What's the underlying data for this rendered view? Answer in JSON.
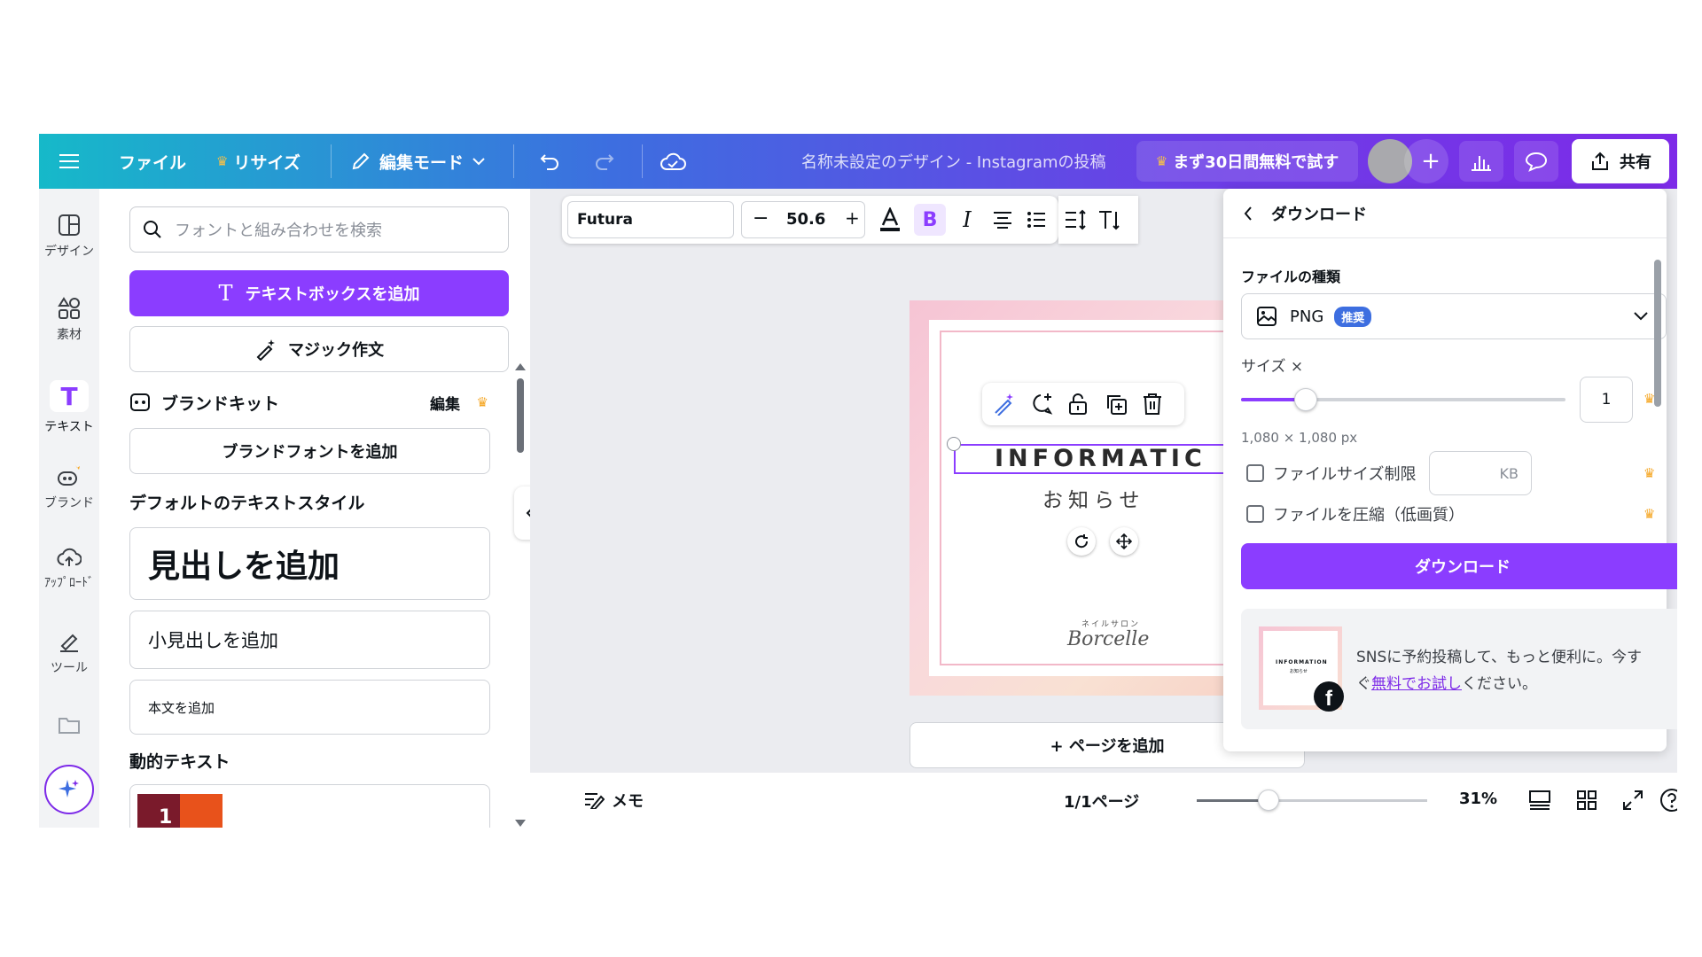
{
  "topbar": {
    "file_label": "ファイル",
    "resize_label": "リサイズ",
    "edit_mode_label": "編集モード",
    "doc_title": "名称未設定のデザイン - Instagramの投稿",
    "trial_label": "まず30日間無料で試す",
    "share_label": "共有"
  },
  "leftnav": {
    "items": [
      {
        "label": "デザイン"
      },
      {
        "label": "素材"
      },
      {
        "label": "テキスト"
      },
      {
        "label": "ブランド"
      },
      {
        "label": "ｱｯﾌﾟﾛｰﾄﾞ"
      },
      {
        "label": "ツール"
      }
    ]
  },
  "panel": {
    "search_placeholder": "フォントと組み合わせを検索",
    "add_textbox_label": "テキストボックスを追加",
    "magic_write_label": "マジック作文",
    "brand_kit_label": "ブランドキット",
    "brand_kit_edit": "編集",
    "add_brand_font_label": "ブランドフォントを追加",
    "default_styles_heading": "デフォルトのテキストスタイル",
    "heading_card": "見出しを追加",
    "subheading_card": "小見出しを追加",
    "body_card": "本文を追加",
    "dynamic_text_heading": "動的テキスト",
    "dynamic_thumb_num": "1"
  },
  "toolbar": {
    "font_name": "Futura",
    "font_size": "50.6",
    "minus": "−",
    "plus": "+",
    "bold": "B",
    "italic": "I"
  },
  "canvas": {
    "info_text": "INFORMATIC",
    "oshirase": "お知らせ",
    "brand_small": "ネイルサロン",
    "brand_name": "Borcelle",
    "add_page_label": "+ ページを追加"
  },
  "bottombar": {
    "memo_label": "メモ",
    "page_indicator": "1/1ページ",
    "zoom": "31%",
    "zoom_fraction": 0.31
  },
  "download": {
    "title": "ダウンロード",
    "file_type_label": "ファイルの種類",
    "file_type_value": "PNG",
    "recommended_badge": "推奨",
    "size_label": "サイズ ×",
    "size_value": "1",
    "size_slider_fraction": 0.2,
    "dimensions": "1,080 × 1,080 px",
    "file_size_limit_label": "ファイルサイズ制限",
    "kb_placeholder": "KB",
    "compress_label": "ファイルを圧縮（低画質）",
    "download_button": "ダウンロード",
    "promo_text_1": "SNSに予約投稿して、もっと便利に。今す",
    "promo_text_2_pre": "ぐ",
    "promo_link": "無料でお試し",
    "promo_text_2_post": "ください。",
    "thumb_title": "INFORMATION",
    "thumb_sub": "お知らせ"
  },
  "colors": {
    "accent": "#8b3dff",
    "crown": "#f5a623"
  }
}
